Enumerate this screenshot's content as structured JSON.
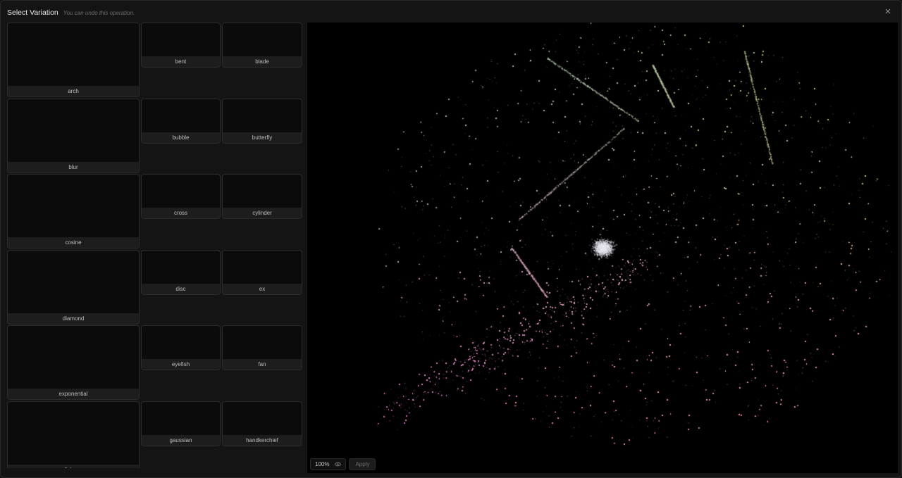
{
  "dialog": {
    "title": "Select Variation",
    "subtitle": "You can undo this operation.",
    "close_icon": "close-icon"
  },
  "variations": [
    {
      "big": "arch",
      "small": [
        "bent",
        "blade"
      ]
    },
    {
      "big": "blur",
      "small": [
        "bubble",
        "butterfly"
      ]
    },
    {
      "big": "cosine",
      "small": [
        "cross",
        "cylinder"
      ]
    },
    {
      "big": "diamond",
      "small": [
        "disc",
        "ex"
      ]
    },
    {
      "big": "exponential",
      "small": [
        "eyefish",
        "fan"
      ]
    },
    {
      "big": "fisheye",
      "small": [
        "gaussian",
        "handkerchief"
      ]
    }
  ],
  "preview": {
    "zoom": "100%",
    "visibility_icon": "eye-icon",
    "apply_label": "Apply"
  },
  "colors": {
    "background": "#141414",
    "canvas": "#000000",
    "card": "#0b0b0b",
    "card_label_bg": "#1d1d1d"
  }
}
